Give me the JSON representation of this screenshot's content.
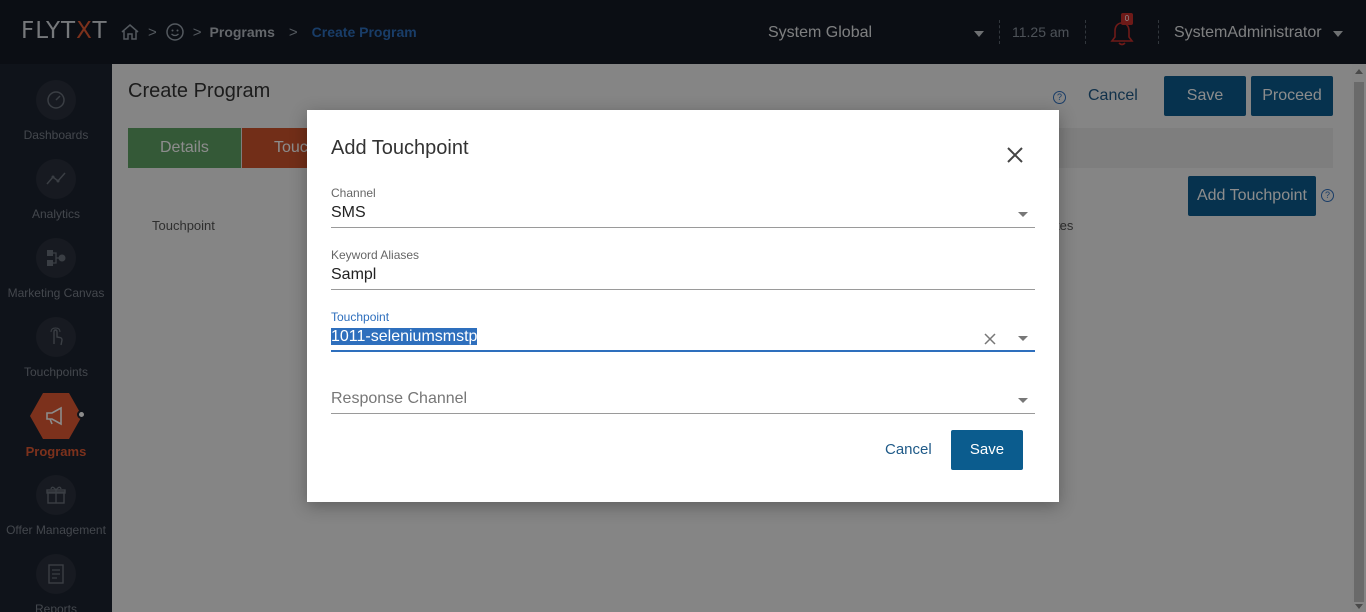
{
  "header": {
    "logo": "FLYTXT",
    "breadcrumb": [
      "Programs",
      "Create Program"
    ],
    "region": "System Global",
    "time": "11.25 am",
    "notification_count": "0",
    "user": "SystemAdministrator"
  },
  "sidebar": {
    "items": [
      {
        "label": "Dashboards",
        "icon": "gauge-icon"
      },
      {
        "label": "Analytics",
        "icon": "line-chart-icon"
      },
      {
        "label": "Marketing Canvas",
        "icon": "flow-icon"
      },
      {
        "label": "Touchpoints",
        "icon": "touch-hand-icon"
      },
      {
        "label": "Programs",
        "icon": "megaphone-icon",
        "active": true
      },
      {
        "label": "Offer Management",
        "icon": "gift-icon"
      },
      {
        "label": "Reports",
        "icon": "report-icon"
      }
    ]
  },
  "main": {
    "title": "Create Program",
    "cancel_label": "Cancel",
    "save_label": "Save",
    "proceed_label": "Proceed",
    "tabs": [
      {
        "label": "Details",
        "color": "#5fa365"
      },
      {
        "label": "Touc",
        "color": "#d0552c"
      }
    ],
    "add_touchpoint_label": "Add Touchpoint",
    "columns": [
      "Touchpoint",
      "tes"
    ]
  },
  "modal": {
    "title": "Add Touchpoint",
    "channel": {
      "label": "Channel",
      "value": "SMS"
    },
    "keyword_aliases": {
      "label": "Keyword Aliases",
      "value": "Sampl"
    },
    "touchpoint": {
      "label": "Touchpoint",
      "value": "1011-seleniumsmstp"
    },
    "response_channel": {
      "placeholder": "Response Channel"
    },
    "cancel_label": "Cancel",
    "save_label": "Save"
  },
  "colors": {
    "accent": "#e25a33",
    "primary": "#0b5c8e",
    "focus": "#2e6fbd"
  }
}
